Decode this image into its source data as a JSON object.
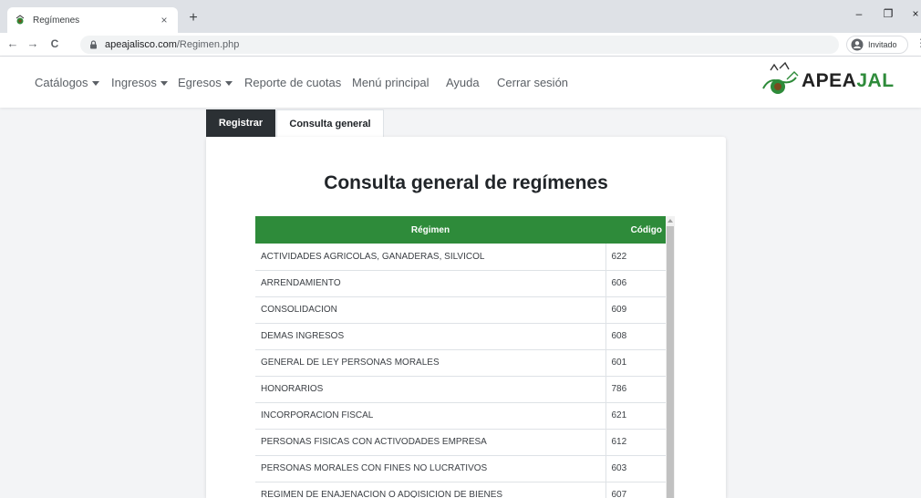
{
  "browser": {
    "tab_title": "Regímenes",
    "tab_close": "×",
    "new_tab": "+",
    "url_host": "apeajalisco.com",
    "url_path": "/Regimen.php",
    "profile_label": "Invitado",
    "win_minimize": "–",
    "win_restore": "❐",
    "win_close": "×",
    "back": "←",
    "forward": "→",
    "reload": "C",
    "menu": "⋮"
  },
  "navbar": {
    "items": [
      {
        "label": "Catálogos",
        "dropdown": true
      },
      {
        "label": "Ingresos",
        "dropdown": true
      },
      {
        "label": "Egresos",
        "dropdown": true
      },
      {
        "label": "Reporte de cuotas",
        "dropdown": false
      },
      {
        "label": "Menú principal",
        "dropdown": false
      },
      {
        "label": "Ayuda",
        "dropdown": false
      },
      {
        "label": "Cerrar sesión",
        "dropdown": false
      }
    ],
    "logo_text_a": "APEA",
    "logo_text_b": "JAL"
  },
  "tabs": {
    "register": "Registrar",
    "consult": "Consulta general"
  },
  "page": {
    "heading": "Consulta general de regímenes"
  },
  "table": {
    "headers": {
      "regimen": "Régimen",
      "codigo": "Código"
    },
    "rows": [
      {
        "regimen": "ACTIVIDADES AGRICOLAS, GANADERAS, SILVICOL",
        "codigo": "622"
      },
      {
        "regimen": "ARRENDAMIENTO",
        "codigo": "606"
      },
      {
        "regimen": "CONSOLIDACION",
        "codigo": "609"
      },
      {
        "regimen": "DEMAS INGRESOS",
        "codigo": "608"
      },
      {
        "regimen": "GENERAL DE LEY PERSONAS MORALES",
        "codigo": "601"
      },
      {
        "regimen": "HONORARIOS",
        "codigo": "786"
      },
      {
        "regimen": "INCORPORACION FISCAL",
        "codigo": "621"
      },
      {
        "regimen": "PERSONAS FISICAS CON ACTIVODADES EMPRESA",
        "codigo": "612"
      },
      {
        "regimen": "PERSONAS MORALES CON FINES NO LUCRATIVOS",
        "codigo": "603"
      },
      {
        "regimen": "REGIMEN DE ENAJENACION O ADQISICION DE BIENES",
        "codigo": "607"
      }
    ]
  },
  "colors": {
    "header_green": "#2e8b3a",
    "tab_dark": "#2b3034"
  }
}
